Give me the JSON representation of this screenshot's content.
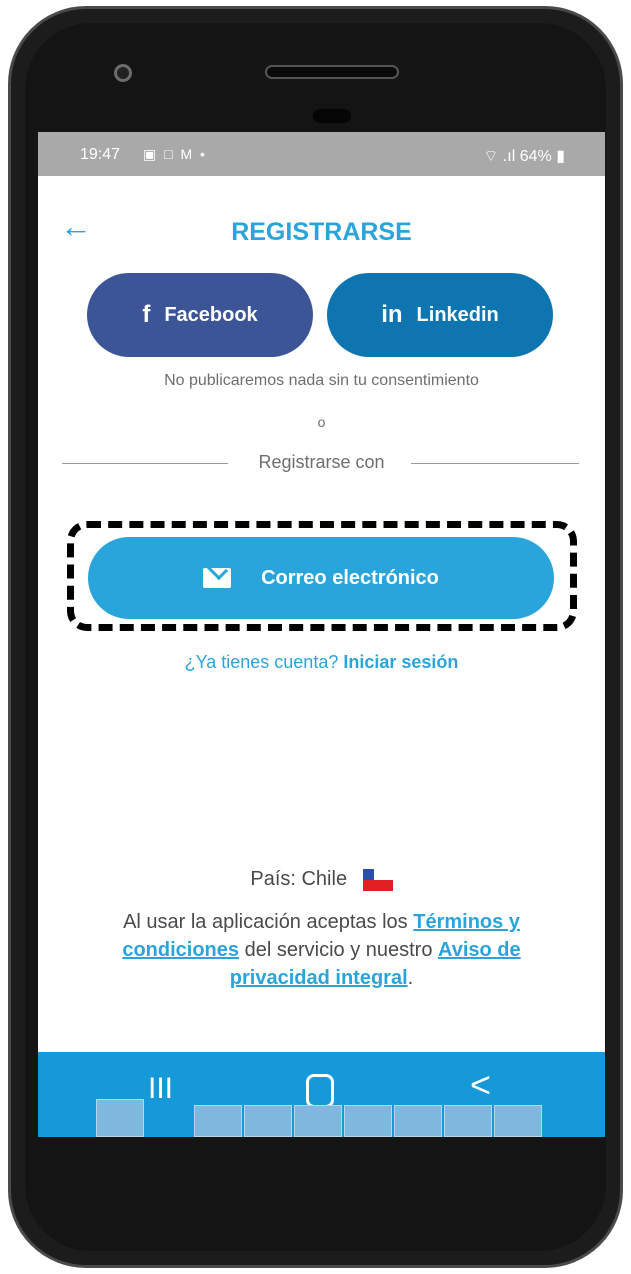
{
  "status_bar": {
    "time": "19:47",
    "icons": "▣ □ M •",
    "battery": "64%",
    "signal": "⌔ .ıl"
  },
  "header": {
    "back_icon": "←",
    "title": "REGISTRARSE"
  },
  "social": {
    "facebook_icon": "f",
    "facebook_label": "Facebook",
    "linkedin_icon": "in",
    "linkedin_label": "Linkedin"
  },
  "disclaimer": "No publicaremos nada sin tu consentimiento",
  "or_text": "o",
  "divider_label": "Registrarse con",
  "email_button_label": "Correo electrónico",
  "login": {
    "prefix": "¿Ya tienes cuenta?",
    "link": "Iniciar sesión"
  },
  "country": {
    "label": "País: Chile",
    "flag": "Chile"
  },
  "terms": {
    "part1": "Al usar la aplicación aceptas los",
    "link1": "Términos y condiciones",
    "part2": "del servicio y nuestro",
    "link2": "Aviso de privacidad integral",
    "part3": "."
  },
  "navbar": {
    "recent_icon": "III",
    "back_icon": "<"
  },
  "colors": {
    "accent": "#2aa5dc",
    "facebook": "#3b5596",
    "linkedin": "#0e75b0",
    "navbar": "#1599d8"
  }
}
